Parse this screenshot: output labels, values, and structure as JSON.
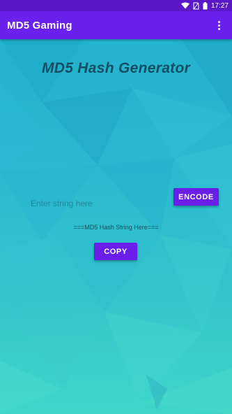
{
  "status_bar": {
    "time": "17:27",
    "icons": [
      "wifi-icon",
      "no-sim-icon",
      "battery-icon"
    ]
  },
  "app_bar": {
    "title": "MD5 Gaming",
    "menu_icon": "overflow-menu-icon"
  },
  "main": {
    "heading": "MD5 Hash Generator",
    "input_placeholder": "Enter string here",
    "input_value": "",
    "encode_label": "ENCODE",
    "hash_output": "===MD5 Hash String Here===",
    "copy_label": "COPY"
  },
  "colors": {
    "status_bar": "#5b18c9",
    "app_bar": "#6a21ee",
    "button": "#6a1eea",
    "heading": "#134e64",
    "background_top": "#22b2cd",
    "background_bottom": "#3ed6c9"
  }
}
